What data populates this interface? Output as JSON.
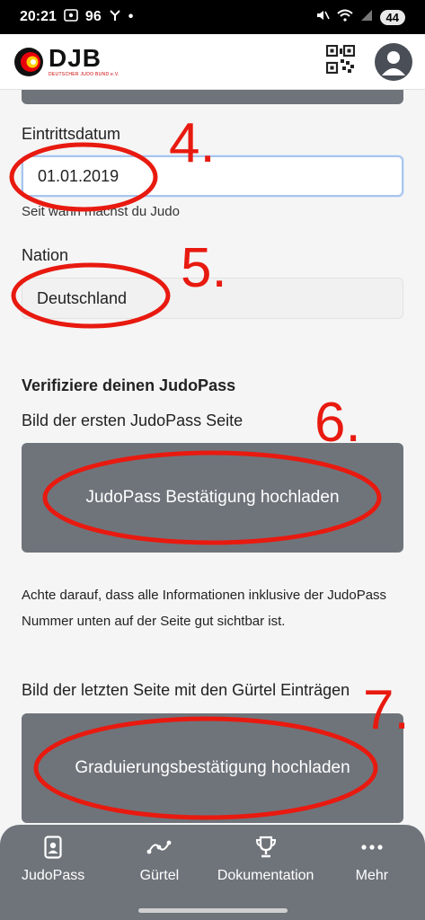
{
  "status_bar": {
    "time": "20:21",
    "signal_label": "96",
    "battery": "44"
  },
  "header": {
    "logo_text": "DJB",
    "logo_subtext": "DEUTSCHER JUDO BUND e.V.",
    "qr_icon": "qr-code-icon",
    "avatar_icon": "user-avatar-icon"
  },
  "form": {
    "entry_date_label": "Eintrittsdatum",
    "entry_date_value": "01.01.2019",
    "entry_date_help": "Seit wann machst du Judo",
    "nation_label": "Nation",
    "nation_value": "Deutschland"
  },
  "verify": {
    "title": "Verifiziere deinen JudoPass",
    "first_page_label": "Bild der ersten JudoPass Seite",
    "upload_judopass_button": "JudoPass Bestätigung hochladen",
    "note": "Achte darauf, dass alle Informationen inklusive der JudoPass Nummer unten auf der Seite gut sichtbar ist.",
    "last_page_label": "Bild der letzten Seite mit den Gürtel Einträgen",
    "upload_grade_button": "Graduierungsbestätigung hochladen"
  },
  "annotations": {
    "n4": "4.",
    "n5": "5.",
    "n6": "6.",
    "n7": "7."
  },
  "nav": [
    {
      "label": "JudoPass",
      "icon": "id-card-icon"
    },
    {
      "label": "Gürtel",
      "icon": "belt-path-icon"
    },
    {
      "label": "Dokumentation",
      "icon": "trophy-icon"
    },
    {
      "label": "Mehr",
      "icon": "more-dots-icon"
    }
  ],
  "colors": {
    "panel": "#6f747b",
    "annotation": "#e81a10",
    "focus_border": "#a7c4ee"
  }
}
